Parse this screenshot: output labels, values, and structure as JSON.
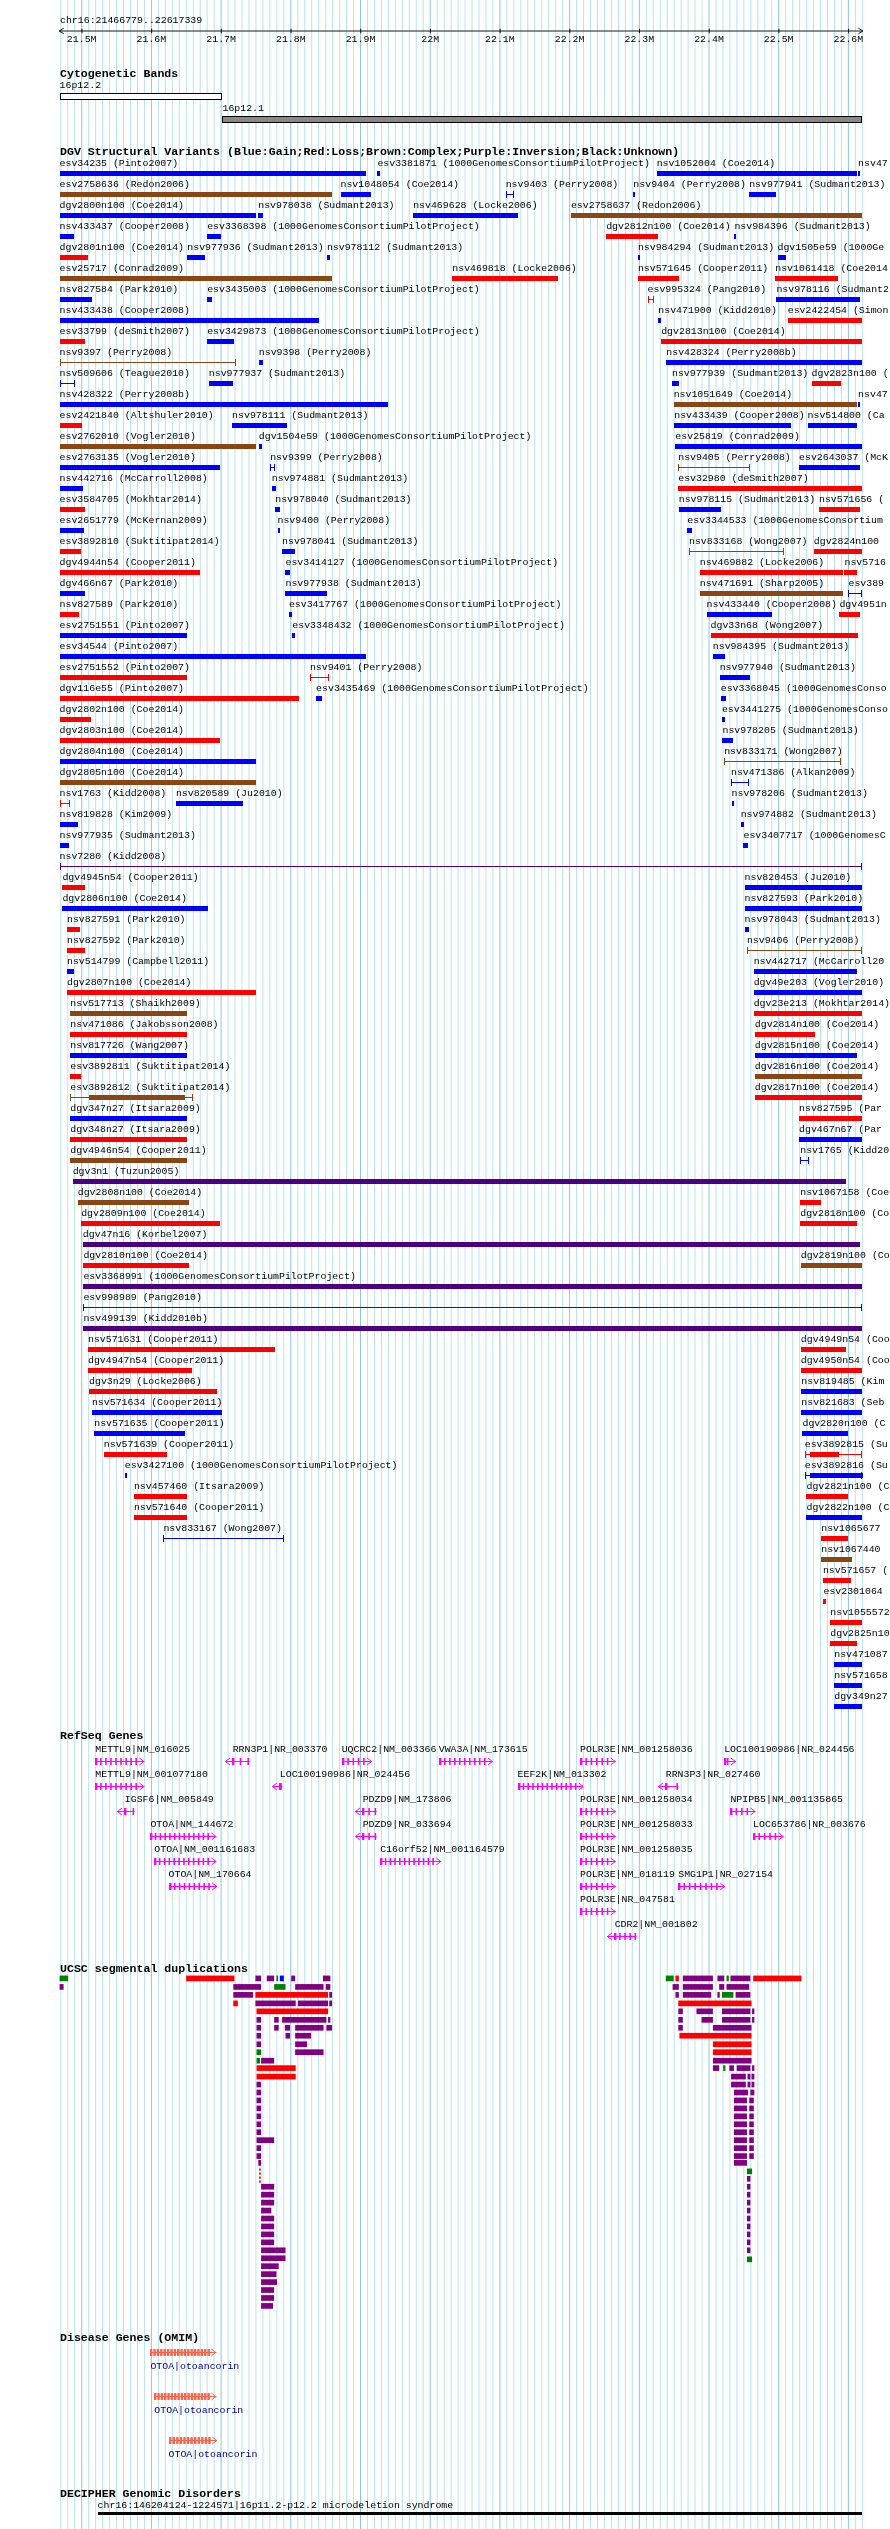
{
  "region": "chr16:21466779..22617339",
  "axis": {
    "ticks": [
      "21.5M",
      "21.6M",
      "21.7M",
      "21.8M",
      "21.9M",
      "22M",
      "22.1M",
      "22.2M",
      "22.3M",
      "22.4M",
      "22.5M",
      "22.6M"
    ]
  },
  "tracks": [
    {
      "kind": "bands",
      "title": "Cytogenetic Bands",
      "bands": [
        {
          "name": "16p12.2",
          "color": "#ffffff"
        },
        {
          "name": "16p12.1",
          "color": "#888888"
        }
      ]
    },
    {
      "kind": "variants",
      "title": "DGV Structural Variants (Blue:Gain;Red:Loss;Brown:Complex;Purple:Inversion;Black:Unknown)",
      "rows": [
        {
          "features": [
            {
              "label": "esv34235 (Pinto2007)",
              "color": "#0000ff",
              "kind": "bar"
            },
            {
              "label": "esv3381871 (1000GenomesConsortiumPilotProject)",
              "color": "#0000ff",
              "kind": "bar"
            },
            {
              "label": "nsv1052004 (Coe2014)",
              "color": "#0000ff",
              "kind": "bar"
            },
            {
              "label": "nsv47",
              "color": "#0000ff",
              "kind": "bar"
            }
          ]
        },
        {
          "features": [
            {
              "label": "esv2758636 (Redon2006)",
              "color": "#8b4513",
              "kind": "bar"
            },
            {
              "label": "nsv1048054 (Coe2014)",
              "color": "#0000ff",
              "kind": "bar"
            },
            {
              "label": "nsv9403 (Perry2008)",
              "color": "#0000ff",
              "kind": "span"
            },
            {
              "label": "nsv9404 (Perry2008)",
              "color": "#0000ff",
              "kind": "bar"
            },
            {
              "label": "nsv977941 (Sudmant2013)",
              "color": "#0000ff",
              "kind": "bar"
            }
          ]
        },
        {
          "features": [
            {
              "label": "dgv2800n100 (Coe2014)",
              "color": "#0000ff",
              "kind": "bar"
            },
            {
              "label": "nsv978038 (Sudmant2013)",
              "color": "#0000ff",
              "kind": "bar"
            },
            {
              "label": "nsv469628 (Locke2006)",
              "color": "#0000ff",
              "kind": "bar"
            },
            {
              "label": "esv2758637 (Redon2006)",
              "color": "#8b4513",
              "kind": "bar"
            }
          ]
        },
        {
          "features": [
            {
              "label": "nsv433437 (Cooper2008)",
              "color": "#0000ff",
              "kind": "bar"
            },
            {
              "label": "esv3368398 (1000GenomesConsortiumPilotProject)",
              "color": "#0000ff",
              "kind": "bar"
            },
            {
              "label": "dgv2812n100 (Coe2014)",
              "color": "#ff0000",
              "kind": "bar"
            },
            {
              "label": "nsv984396 (Sudmant2013)",
              "color": "#0000ff",
              "kind": "bar"
            }
          ]
        },
        {
          "features": [
            {
              "label": "dgv2801n100 (Coe2014)",
              "color": "#ff0000",
              "kind": "bar"
            },
            {
              "label": "nsv977936 (Sudmant2013)",
              "color": "#0000ff",
              "kind": "bar"
            },
            {
              "label": "nsv978112 (Sudmant2013)",
              "color": "#0000ff",
              "kind": "bar"
            },
            {
              "label": "nsv984294 (Sudmant2013)",
              "color": "#0000ff",
              "kind": "bar"
            },
            {
              "label": "dgv1505e59 (1000Ge",
              "color": "#0000ff",
              "kind": "bar"
            }
          ]
        },
        {
          "features": [
            {
              "label": "esv25717 (Conrad2009)",
              "color": "#8b4513",
              "kind": "bar"
            },
            {
              "label": "nsv469818 (Locke2006)",
              "color": "#ff0000",
              "kind": "bar"
            },
            {
              "label": "nsv571645 (Cooper2011)",
              "color": "#ff0000",
              "kind": "bar"
            },
            {
              "label": "nsv1061418 (Coe2014",
              "color": "#ff0000",
              "kind": "bar"
            }
          ]
        },
        {
          "features": [
            {
              "label": "nsv827584 (Park2010)",
              "color": "#0000ff",
              "kind": "bar"
            },
            {
              "label": "esv3435003 (1000GenomesConsortiumPilotProject)",
              "color": "#0000ff",
              "kind": "bar"
            },
            {
              "label": "esv995324 (Pang2010)",
              "color": "#ff0000",
              "kind": "span"
            },
            {
              "label": "nsv978116 (Sudmant2",
              "color": "#0000ff",
              "kind": "bar"
            }
          ]
        },
        {
          "features": [
            {
              "label": "nsv433438 (Cooper2008)",
              "color": "#0000ff",
              "kind": "bar"
            },
            {
              "label": "nsv471900 (Kidd2010)",
              "color": "#0000ff",
              "kind": "bar"
            },
            {
              "label": "esv2422454 (Simon",
              "color": "#ff0000",
              "kind": "bar"
            }
          ]
        },
        {
          "features": [
            {
              "label": "esv33799 (deSmith2007)",
              "color": "#ff0000",
              "kind": "bar"
            },
            {
              "label": "esv3429873 (1000GenomesConsortiumPilotProject)",
              "color": "#0000ff",
              "kind": "bar"
            },
            {
              "label": "dgv2813n100 (Coe2014)",
              "color": "#ff0000",
              "kind": "bar"
            }
          ]
        },
        {
          "features": [
            {
              "label": "nsv9397 (Perry2008)",
              "color": "#8b4513",
              "kind": "span"
            },
            {
              "label": "nsv9398 (Perry2008)",
              "color": "#0000ff",
              "kind": "bar"
            },
            {
              "label": "nsv428324 (Perry2008b)",
              "color": "#0000ff",
              "kind": "bar"
            }
          ]
        },
        {
          "features": [
            {
              "label": "nsv509606 (Teague2010)",
              "color": "#0000ff",
              "kind": "span"
            },
            {
              "label": "nsv977937 (Sudmant2013)",
              "color": "#0000ff",
              "kind": "bar"
            },
            {
              "label": "nsv977939 (Sudmant2013)",
              "color": "#0000ff",
              "kind": "bar"
            },
            {
              "label": "dgv2823n100 (",
              "color": "#ff0000",
              "kind": "bar"
            }
          ]
        },
        {
          "features": [
            {
              "label": "nsv428322 (Perry2008b)",
              "color": "#0000ff",
              "kind": "bar"
            },
            {
              "label": "nsv1051649 (Coe2014)",
              "color": "#8b4513",
              "kind": "bar"
            },
            {
              "label": "nsv47",
              "color": "#0000ff",
              "kind": "bar"
            }
          ]
        },
        {
          "features": [
            {
              "label": "esv2421840 (Altshuler2010)",
              "color": "#ff0000",
              "kind": "bar"
            },
            {
              "label": "nsv978111 (Sudmant2013)",
              "color": "#0000ff",
              "kind": "bar"
            },
            {
              "label": "nsv433439 (Cooper2008)",
              "color": "#0000ff",
              "kind": "bar"
            },
            {
              "label": "nsv514800 (Ca",
              "color": "#0000ff",
              "kind": "bar"
            }
          ]
        },
        {
          "features": [
            {
              "label": "esv2762010 (Vogler2010)",
              "color": "#8b4513",
              "kind": "bar"
            },
            {
              "label": "dgv1504e59 (1000GenomesConsortiumPilotProject)",
              "color": "#0000ff",
              "kind": "bar"
            },
            {
              "label": "esv25819 (Conrad2009)",
              "color": "#0000ff",
              "kind": "bar"
            }
          ]
        },
        {
          "features": [
            {
              "label": "esv2763135 (Vogler2010)",
              "color": "#0000ff",
              "kind": "bar"
            },
            {
              "label": "nsv9399 (Perry2008)",
              "color": "#0000ff",
              "kind": "span"
            },
            {
              "label": "nsv9405 (Perry2008)",
              "color": "#8b4513",
              "kind": "span"
            },
            {
              "label": "esv2643037 (McK",
              "color": "#0000ff",
              "kind": "bar"
            }
          ]
        },
        {
          "features": [
            {
              "label": "nsv442716 (McCarroll2008)",
              "color": "#0000ff",
              "kind": "bar"
            },
            {
              "label": "nsv974881 (Sudmant2013)",
              "color": "#0000ff",
              "kind": "bar"
            },
            {
              "label": "esv32980 (deSmith2007)",
              "color": "#ff0000",
              "kind": "bar"
            }
          ]
        },
        {
          "features": [
            {
              "label": "esv3584705 (Mokhtar2014)",
              "color": "#ff0000",
              "kind": "bar"
            },
            {
              "label": "nsv978040 (Sudmant2013)",
              "color": "#0000ff",
              "kind": "bar"
            },
            {
              "label": "nsv978115 (Sudmant2013)",
              "color": "#0000ff",
              "kind": "bar"
            },
            {
              "label": "nsv571656 (",
              "color": "#ff0000",
              "kind": "bar"
            }
          ]
        },
        {
          "features": [
            {
              "label": "esv2651779 (McKernan2009)",
              "color": "#0000ff",
              "kind": "bar"
            },
            {
              "label": "nsv9400 (Perry2008)",
              "color": "#0000ff",
              "kind": "bar"
            },
            {
              "label": "esv3344533 (1000GenomesConsortium",
              "color": "#0000ff",
              "kind": "bar"
            }
          ]
        },
        {
          "features": [
            {
              "label": "esv3892810 (Suktitipat2014)",
              "color": "#ff0000",
              "kind": "bar"
            },
            {
              "label": "nsv978041 (Sudmant2013)",
              "color": "#0000ff",
              "kind": "bar"
            },
            {
              "label": "nsv833168 (Wong2007)",
              "color": "#8b4513",
              "kind": "span"
            },
            {
              "label": "dgv2824n100",
              "color": "#ff0000",
              "kind": "bar"
            }
          ]
        },
        {
          "features": [
            {
              "label": "dgv4944n54 (Cooper2011)",
              "color": "#ff0000",
              "kind": "bar"
            },
            {
              "label": "esv3414127 (1000GenomesConsortiumPilotProject)",
              "color": "#0000ff",
              "kind": "bar"
            },
            {
              "label": "nsv469882 (Locke2006)",
              "color": "#ff0000",
              "kind": "bar"
            },
            {
              "label": "nsv5716",
              "color": "#ff0000",
              "kind": "bar"
            }
          ]
        },
        {
          "features": [
            {
              "label": "dgv466n67 (Park2010)",
              "color": "#0000ff",
              "kind": "bar"
            },
            {
              "label": "nsv977938 (Sudmant2013)",
              "color": "#0000ff",
              "kind": "bar"
            },
            {
              "label": "nsv471691 (Sharp2005)",
              "color": "#8b4513",
              "kind": "bar"
            },
            {
              "label": "esv389",
              "color": "#0000ff",
              "kind": "span"
            }
          ]
        },
        {
          "features": [
            {
              "label": "nsv827589 (Park2010)",
              "color": "#ff0000",
              "kind": "bar"
            },
            {
              "label": "esv3417767 (1000GenomesConsortiumPilotProject)",
              "color": "#0000ff",
              "kind": "bar"
            },
            {
              "label": "nsv433440 (Cooper2008)",
              "color": "#0000ff",
              "kind": "bar"
            },
            {
              "label": "dgv4951n",
              "color": "#ff0000",
              "kind": "bar"
            }
          ]
        },
        {
          "features": [
            {
              "label": "esv2751551 (Pinto2007)",
              "color": "#0000ff",
              "kind": "bar"
            },
            {
              "label": "esv3348432 (1000GenomesConsortiumPilotProject)",
              "color": "#0000ff",
              "kind": "bar"
            },
            {
              "label": "dgv33n68 (Wong2007)",
              "color": "#ff0000",
              "kind": "bar"
            }
          ]
        },
        {
          "features": [
            {
              "label": "esv34544 (Pinto2007)",
              "color": "#0000ff",
              "kind": "bar"
            },
            {
              "label": "nsv984395 (Sudmant2013)",
              "color": "#0000ff",
              "kind": "bar"
            }
          ]
        },
        {
          "features": [
            {
              "label": "esv2751552 (Pinto2007)",
              "color": "#ff0000",
              "kind": "bar"
            },
            {
              "label": "nsv9401 (Perry2008)",
              "color": "#ff0000",
              "kind": "span"
            },
            {
              "label": "nsv977940 (Sudmant2013)",
              "color": "#0000ff",
              "kind": "bar"
            }
          ]
        },
        {
          "features": [
            {
              "label": "dgv116e55 (Pinto2007)",
              "color": "#ff0000",
              "kind": "bar"
            },
            {
              "label": "esv3435469 (1000GenomesConsortiumPilotProject)",
              "color": "#0000ff",
              "kind": "bar"
            },
            {
              "label": "esv3368045 (1000GenomesConso",
              "color": "#0000ff",
              "kind": "bar"
            }
          ]
        },
        {
          "features": [
            {
              "label": "dgv2802n100 (Coe2014)",
              "color": "#ff0000",
              "kind": "bar"
            },
            {
              "label": "esv3441275 (1000GenomesConso",
              "color": "#0000ff",
              "kind": "bar"
            }
          ]
        },
        {
          "features": [
            {
              "label": "dgv2803n100 (Coe2014)",
              "color": "#ff0000",
              "kind": "bar"
            },
            {
              "label": "nsv978205 (Sudmant2013)",
              "color": "#0000ff",
              "kind": "bar"
            }
          ]
        },
        {
          "features": [
            {
              "label": "dgv2804n100 (Coe2014)",
              "color": "#0000ff",
              "kind": "bar"
            },
            {
              "label": "nsv833171 (Wong2007)",
              "color": "#8b4513",
              "kind": "span"
            }
          ]
        },
        {
          "features": [
            {
              "label": "dgv2805n100 (Coe2014)",
              "color": "#8b4513",
              "kind": "bar"
            },
            {
              "label": "nsv471386 (Alkan2009)",
              "color": "#0000ff",
              "kind": "span"
            }
          ]
        },
        {
          "features": [
            {
              "label": "nsv1763 (Kidd2008)",
              "color": "#ff0000",
              "kind": "span"
            },
            {
              "label": "nsv820589 (Ju2010)",
              "color": "#0000ff",
              "kind": "bar"
            },
            {
              "label": "nsv978206 (Sudmant2013)",
              "color": "#0000ff",
              "kind": "bar"
            }
          ]
        },
        {
          "features": [
            {
              "label": "nsv819828 (Kim2009)",
              "color": "#0000ff",
              "kind": "bar"
            },
            {
              "label": "nsv974882 (Sudmant2013)",
              "color": "#0000ff",
              "kind": "bar"
            }
          ]
        },
        {
          "features": [
            {
              "label": "nsv977935 (Sudmant2013)",
              "color": "#0000ff",
              "kind": "bar"
            },
            {
              "label": "esv3407717 (1000GenomesC",
              "color": "#0000ff",
              "kind": "bar"
            }
          ]
        },
        {
          "features": [
            {
              "label": "nsv7280 (Kidd2008)",
              "color": "#4b0082",
              "kind": "span"
            }
          ]
        },
        {
          "features": [
            {
              "label": "dgv4945n54 (Cooper2011)",
              "color": "#ff0000",
              "kind": "bar"
            },
            {
              "label": "nsv820453 (Ju2010)",
              "color": "#0000ff",
              "kind": "bar"
            }
          ]
        },
        {
          "features": [
            {
              "label": "dgv2806n100 (Coe2014)",
              "color": "#0000ff",
              "kind": "bar"
            },
            {
              "label": "nsv827593 (Park2010)",
              "color": "#0000ff",
              "kind": "bar"
            }
          ]
        },
        {
          "features": [
            {
              "label": "nsv827591 (Park2010)",
              "color": "#ff0000",
              "kind": "bar"
            },
            {
              "label": "nsv978043 (Sudmant2013)",
              "color": "#0000ff",
              "kind": "bar"
            }
          ]
        },
        {
          "features": [
            {
              "label": "nsv827592 (Park2010)",
              "color": "#ff0000",
              "kind": "bar"
            },
            {
              "label": "nsv9406 (Perry2008)",
              "color": "#8b4513",
              "kind": "span"
            }
          ]
        },
        {
          "features": [
            {
              "label": "nsv514799 (Campbell2011)",
              "color": "#0000ff",
              "kind": "bar"
            },
            {
              "label": "nsv442717 (McCarroll20",
              "color": "#0000ff",
              "kind": "bar"
            }
          ]
        },
        {
          "features": [
            {
              "label": "dgv2807n100 (Coe2014)",
              "color": "#ff0000",
              "kind": "bar"
            },
            {
              "label": "dgv49e203 (Vogler2010)",
              "color": "#0000ff",
              "kind": "bar"
            }
          ]
        },
        {
          "features": [
            {
              "label": "nsv517713 (Shaikh2009)",
              "color": "#8b4513",
              "kind": "bar"
            },
            {
              "label": "dgv23e213 (Mokhtar2014)",
              "color": "#ff0000",
              "kind": "bar"
            }
          ]
        },
        {
          "features": [
            {
              "label": "nsv471086 (Jakobsson2008)",
              "color": "#ff0000",
              "kind": "bar"
            },
            {
              "label": "dgv2814n100 (Coe2014)",
              "color": "#ff0000",
              "kind": "bar"
            }
          ]
        },
        {
          "features": [
            {
              "label": "nsv817726 (Wang2007)",
              "color": "#0000ff",
              "kind": "bar"
            },
            {
              "label": "dgv2815n100 (Coe2014)",
              "color": "#0000ff",
              "kind": "bar"
            }
          ]
        },
        {
          "features": [
            {
              "label": "esv3892811 (Suktitipat2014)",
              "color": "#ff0000",
              "kind": "bar"
            },
            {
              "label": "dgv2816n100 (Coe2014)",
              "color": "#8b4513",
              "kind": "bar"
            }
          ]
        },
        {
          "features": [
            {
              "label": "esv3892812 (Suktitipat2014)",
              "color": "#8b4513",
              "kind": "mixed"
            },
            {
              "label": "dgv2817n100 (Coe2014)",
              "color": "#ff0000",
              "kind": "bar"
            }
          ]
        },
        {
          "features": [
            {
              "label": "dgv347n27 (Itsara2009)",
              "color": "#0000ff",
              "kind": "bar"
            },
            {
              "label": "nsv827595 (Par",
              "color": "#ff0000",
              "kind": "bar"
            }
          ]
        },
        {
          "features": [
            {
              "label": "dgv348n27 (Itsara2009)",
              "color": "#ff0000",
              "kind": "bar"
            },
            {
              "label": "dgv467n67 (Par",
              "color": "#0000ff",
              "kind": "bar"
            }
          ]
        },
        {
          "features": [
            {
              "label": "dgv4946n54 (Cooper2011)",
              "color": "#8b4513",
              "kind": "bar"
            },
            {
              "label": "nsv1765 (Kidd20",
              "color": "#0000ff",
              "kind": "span"
            }
          ]
        },
        {
          "features": [
            {
              "label": "dgv3n1 (Tuzun2005)",
              "color": "#4b0082",
              "kind": "bar"
            }
          ]
        },
        {
          "features": [
            {
              "label": "dgv2808n100 (Coe2014)",
              "color": "#8b4513",
              "kind": "bar"
            },
            {
              "label": "nsv1067158 (Coe",
              "color": "#ff0000",
              "kind": "bar"
            }
          ]
        },
        {
          "features": [
            {
              "label": "dgv2809n100 (Coe2014)",
              "color": "#ff0000",
              "kind": "bar"
            },
            {
              "label": "dgv2818n100 (Co",
              "color": "#ff0000",
              "kind": "bar"
            }
          ]
        },
        {
          "features": [
            {
              "label": "dgv47n16 (Korbel2007)",
              "color": "#4b0082",
              "kind": "bar"
            }
          ]
        },
        {
          "features": [
            {
              "label": "dgv2810n100 (Coe2014)",
              "color": "#ff0000",
              "kind": "bar"
            },
            {
              "label": "dgv2819n100 (Co",
              "color": "#8b4513",
              "kind": "bar"
            }
          ]
        },
        {
          "features": [
            {
              "label": "esv3368991 (1000GenomesConsortiumPilotProject)",
              "color": "#4b0082",
              "kind": "bar"
            }
          ]
        },
        {
          "features": [
            {
              "label": "esv998989 (Pang2010)",
              "color": "#4b0082",
              "kind": "span"
            }
          ]
        },
        {
          "features": [
            {
              "label": "nsv499139 (Kidd2010b)",
              "color": "#4b0082",
              "kind": "bar"
            }
          ]
        },
        {
          "features": [
            {
              "label": "nsv571631 (Cooper2011)",
              "color": "#ff0000",
              "kind": "bar"
            },
            {
              "label": "dgv4949n54 (Coo",
              "color": "#ff0000",
              "kind": "bar"
            }
          ]
        },
        {
          "features": [
            {
              "label": "dgv4947n54 (Cooper2011)",
              "color": "#ff0000",
              "kind": "bar"
            },
            {
              "label": "dgv4950n54 (Coo",
              "color": "#ff0000",
              "kind": "bar"
            }
          ]
        },
        {
          "features": [
            {
              "label": "dgv3n29 (Locke2006)",
              "color": "#ff0000",
              "kind": "bar"
            },
            {
              "label": "nsv819485 (Kim",
              "color": "#0000ff",
              "kind": "bar"
            }
          ]
        },
        {
          "features": [
            {
              "label": "nsv571634 (Cooper2011)",
              "color": "#0000ff",
              "kind": "bar"
            },
            {
              "label": "nsv821683 (Seb",
              "color": "#0000ff",
              "kind": "bar"
            }
          ]
        },
        {
          "features": [
            {
              "label": "nsv571635 (Cooper2011)",
              "color": "#0000ff",
              "kind": "bar"
            },
            {
              "label": "dgv2820n100 (C",
              "color": "#0000ff",
              "kind": "bar"
            }
          ]
        },
        {
          "features": [
            {
              "label": "nsv571639 (Cooper2011)",
              "color": "#ff0000",
              "kind": "bar"
            },
            {
              "label": "esv3892815 (Su",
              "color": "#ff0000",
              "kind": "mixed"
            }
          ]
        },
        {
          "features": [
            {
              "label": "esv3427100 (1000GenomesConsortiumPilotProject)",
              "color": "#0000ff",
              "kind": "bar"
            },
            {
              "label": "esv3892816 (Su",
              "color": "#0000ff",
              "kind": "mixed"
            }
          ]
        },
        {
          "features": [
            {
              "label": "nsv457460 (Itsara2009)",
              "color": "#ff0000",
              "kind": "bar"
            },
            {
              "label": "dgv2821n100 (C",
              "color": "#ff0000",
              "kind": "bar"
            }
          ]
        },
        {
          "features": [
            {
              "label": "nsv571640 (Cooper2011)",
              "color": "#ff0000",
              "kind": "bar"
            },
            {
              "label": "dgv2822n100 (C",
              "color": "#0000ff",
              "kind": "bar"
            }
          ]
        },
        {
          "features": [
            {
              "label": "nsv833167 (Wong2007)",
              "color": "#0000ff",
              "kind": "span"
            },
            {
              "label": "nsv1065677",
              "color": "#ff0000",
              "kind": "bar"
            }
          ]
        },
        {
          "features": [
            {
              "label": "nsv1067440",
              "color": "#8b4513",
              "kind": "bar"
            }
          ]
        },
        {
          "features": [
            {
              "label": "nsv571657 (",
              "color": "#ff0000",
              "kind": "bar"
            }
          ]
        },
        {
          "features": [
            {
              "label": "esv2301064",
              "color": "#ff0000",
              "kind": "bar"
            }
          ]
        },
        {
          "features": [
            {
              "label": "nsv1055572",
              "color": "#ff0000",
              "kind": "bar"
            }
          ]
        },
        {
          "features": [
            {
              "label": "dgv2825n10",
              "color": "#ff0000",
              "kind": "bar"
            }
          ]
        },
        {
          "features": [
            {
              "label": "nsv471087",
              "color": "#0000ff",
              "kind": "bar"
            }
          ]
        },
        {
          "features": [
            {
              "label": "nsv571658",
              "color": "#0000ff",
              "kind": "bar"
            }
          ]
        },
        {
          "features": [
            {
              "label": "dgv349n27",
              "color": "#0000ff",
              "kind": "bar"
            }
          ]
        }
      ]
    },
    {
      "kind": "genes",
      "title": "RefSeq Genes",
      "rows": [
        {
          "genes": [
            {
              "label": "METTL9|NM_016025"
            },
            {
              "label": "RRN3P1|NR_003370"
            },
            {
              "label": "UQCRC2|NM_003366"
            },
            {
              "label": "VWA3A|NM_173615"
            },
            {
              "label": "POLR3E|NM_001258036"
            },
            {
              "label": "LOC100190986|NR_024456"
            }
          ]
        },
        {
          "genes": [
            {
              "label": "METTL9|NM_001077180"
            },
            {
              "label": "LOC100190986|NR_024456"
            },
            {
              "label": "EEF2K|NM_013302"
            },
            {
              "label": "RRN3P3|NR_027460"
            }
          ]
        },
        {
          "genes": [
            {
              "label": "IGSF6|NM_005849"
            },
            {
              "label": "PDZD9|NM_173806"
            },
            {
              "label": "POLR3E|NM_001258034"
            },
            {
              "label": "NPIPB5|NM_001135865"
            }
          ]
        },
        {
          "genes": [
            {
              "label": "OTOA|NM_144672"
            },
            {
              "label": "PDZD9|NR_033694"
            },
            {
              "label": "POLR3E|NM_001258033"
            },
            {
              "label": "LOC653786|NR_003676"
            }
          ]
        },
        {
          "genes": [
            {
              "label": "OTOA|NM_001161683"
            },
            {
              "label": "C16orf52|NM_001164579"
            },
            {
              "label": "POLR3E|NM_001258035"
            }
          ]
        },
        {
          "genes": [
            {
              "label": "OTOA|NM_170664"
            },
            {
              "label": "POLR3E|NM_018119"
            },
            {
              "label": "SMG1P1|NR_027154"
            }
          ]
        },
        {
          "genes": [
            {
              "label": "POLR3E|NR_047581"
            }
          ]
        },
        {
          "genes": [
            {
              "label": "CDR2|NM_001802"
            }
          ]
        }
      ]
    },
    {
      "kind": "duplications",
      "title": "UCSC segmental duplications"
    },
    {
      "kind": "disease_genes",
      "title": "Disease Genes (OMIM)",
      "items": [
        {
          "label": "OTOA|otoancorin"
        },
        {
          "label": "OTOA|otoancorin"
        },
        {
          "label": "OTOA|otoancorin"
        }
      ]
    },
    {
      "kind": "disorders",
      "title": "DECIPHER Genomic Disorders",
      "items": [
        {
          "label": "chr16:146204124-1224571|16p11.2-p12.2 microdeletion syndrome"
        }
      ]
    }
  ]
}
